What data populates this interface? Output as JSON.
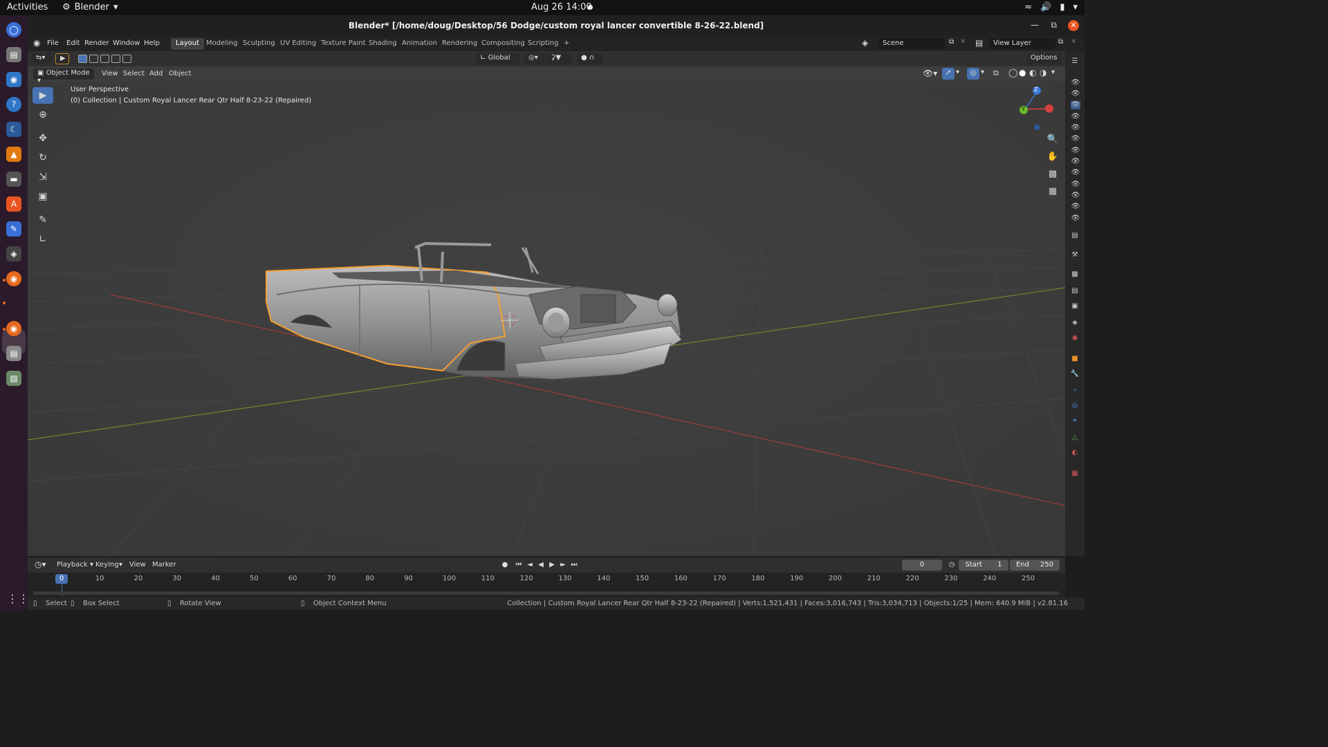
{
  "topbar": {
    "activities": "Activities",
    "app_name": "Blender",
    "clock": "Aug 26  14:00"
  },
  "window": {
    "title": "Blender* [/home/doug/Desktop/56 Dodge/custom royal lancer convertible 8-26-22.blend]"
  },
  "menubar": {
    "items": [
      "File",
      "Edit",
      "Render",
      "Window",
      "Help"
    ],
    "workspaces": [
      "Layout",
      "Modeling",
      "Sculpting",
      "UV Editing",
      "Texture Paint",
      "Shading",
      "Animation",
      "Rendering",
      "Compositing",
      "Scripting"
    ],
    "active_workspace": "Layout",
    "scene": "Scene",
    "view_layer": "View Layer"
  },
  "toolheader": {
    "orientation": "Global",
    "options": "Options"
  },
  "viewport_header": {
    "mode": "Object Mode",
    "menus": [
      "View",
      "Select",
      "Add",
      "Object"
    ]
  },
  "viewport": {
    "perspective": "User Perspective",
    "collection_info": "(0) Collection | Custom Royal Lancer  Rear Qtr  Half 8-23-22 (Repaired)",
    "gizmo_axes": [
      "Z",
      "Y"
    ],
    "colors": {
      "background": "#3d3d3d",
      "selection": "#f5a030",
      "x_axis": "#a23a3a",
      "y_axis": "#6a8a2a"
    }
  },
  "timeline": {
    "menus": [
      "Playback",
      "Keying",
      "View",
      "Marker"
    ],
    "current_frame": "0",
    "start_label": "Start",
    "start_value": "1",
    "end_label": "End",
    "end_value": "250",
    "ruler": [
      "0",
      "10",
      "20",
      "30",
      "40",
      "50",
      "60",
      "70",
      "80",
      "90",
      "100",
      "110",
      "120",
      "130",
      "140",
      "150",
      "160",
      "170",
      "180",
      "190",
      "200",
      "210",
      "220",
      "230",
      "240",
      "250"
    ]
  },
  "statusbar": {
    "select": "Select",
    "box_select": "Box Select",
    "rotate_view": "Rotate View",
    "context_menu": "Object Context Menu",
    "stats": "Collection | Custom Royal Lancer  Rear Qtr  Half 8-23-22 (Repaired) | Verts:1,521,431 | Faces:3,016,743 | Tris:3,034,713 | Objects:1/25 | Mem: 640.9 MiB | v2.81.16"
  }
}
